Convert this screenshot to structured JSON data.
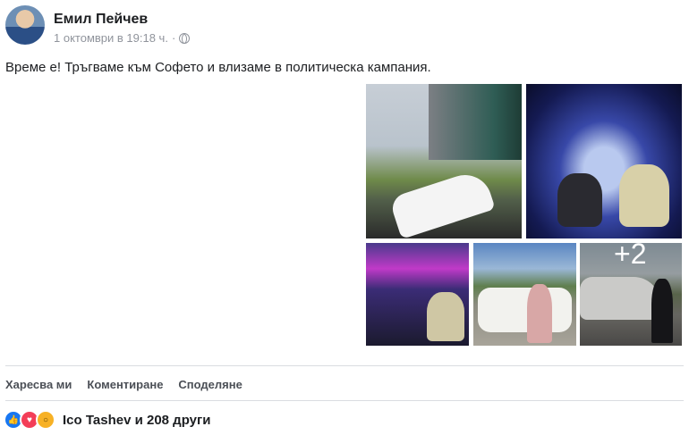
{
  "post": {
    "author": "Емил Пейчев",
    "timestamp": "1 октомври в 19:18 ч.",
    "separator": "·",
    "text": "Време е! Тръгваме към Софето и влизаме в политическа кампания.",
    "more_photos": "+2"
  },
  "actions": {
    "like": "Харесва ми",
    "comment": "Коментиране",
    "share": "Споделяне"
  },
  "reactions": {
    "summary": "Ico Tashev и 208 други",
    "icons": [
      "like-icon",
      "love-icon",
      "wow-icon"
    ]
  },
  "colors": {
    "like": "#1877f2",
    "love": "#f33e58",
    "wow": "#f7b125"
  }
}
